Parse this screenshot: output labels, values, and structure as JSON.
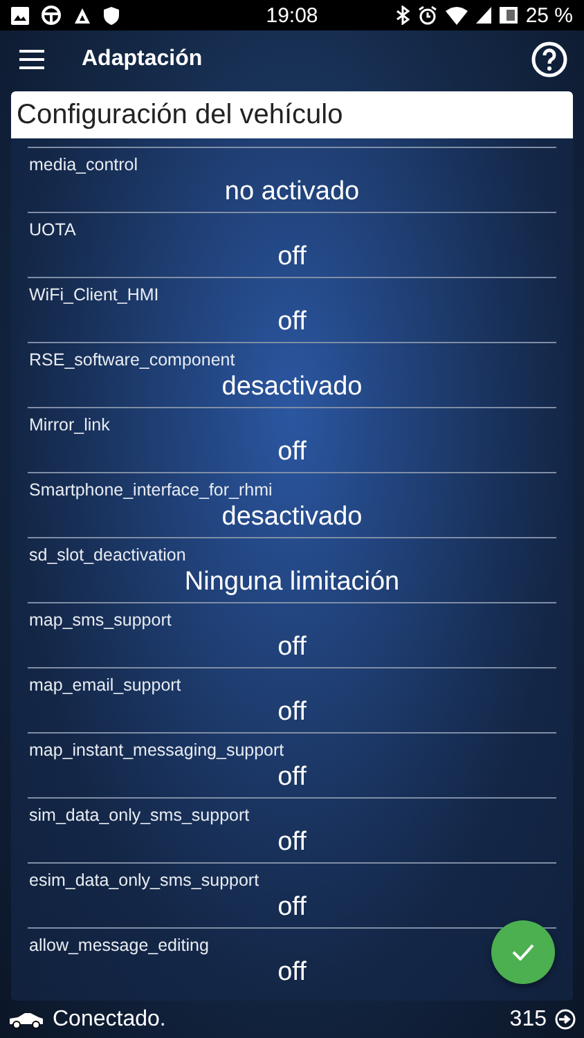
{
  "status_bar": {
    "time": "19:08",
    "battery": "25 %"
  },
  "toolbar": {
    "title": "Adaptación"
  },
  "panel": {
    "title": "Configuración del vehículo"
  },
  "settings": [
    {
      "name": "media_control",
      "value": "no activado"
    },
    {
      "name": "UOTA",
      "value": "off"
    },
    {
      "name": "WiFi_Client_HMI",
      "value": "off"
    },
    {
      "name": "RSE_software_component",
      "value": "desactivado"
    },
    {
      "name": "Mirror_link",
      "value": "off"
    },
    {
      "name": "Smartphone_interface_for_rhmi",
      "value": "desactivado"
    },
    {
      "name": "sd_slot_deactivation",
      "value": "Ninguna limitación"
    },
    {
      "name": "map_sms_support",
      "value": "off"
    },
    {
      "name": "map_email_support",
      "value": "off"
    },
    {
      "name": "map_instant_messaging_support",
      "value": "off"
    },
    {
      "name": "sim_data_only_sms_support",
      "value": "off"
    },
    {
      "name": "esim_data_only_sms_support",
      "value": "off"
    },
    {
      "name": "allow_message_editing",
      "value": "off"
    }
  ],
  "footer": {
    "status": "Conectado.",
    "count": "315"
  }
}
